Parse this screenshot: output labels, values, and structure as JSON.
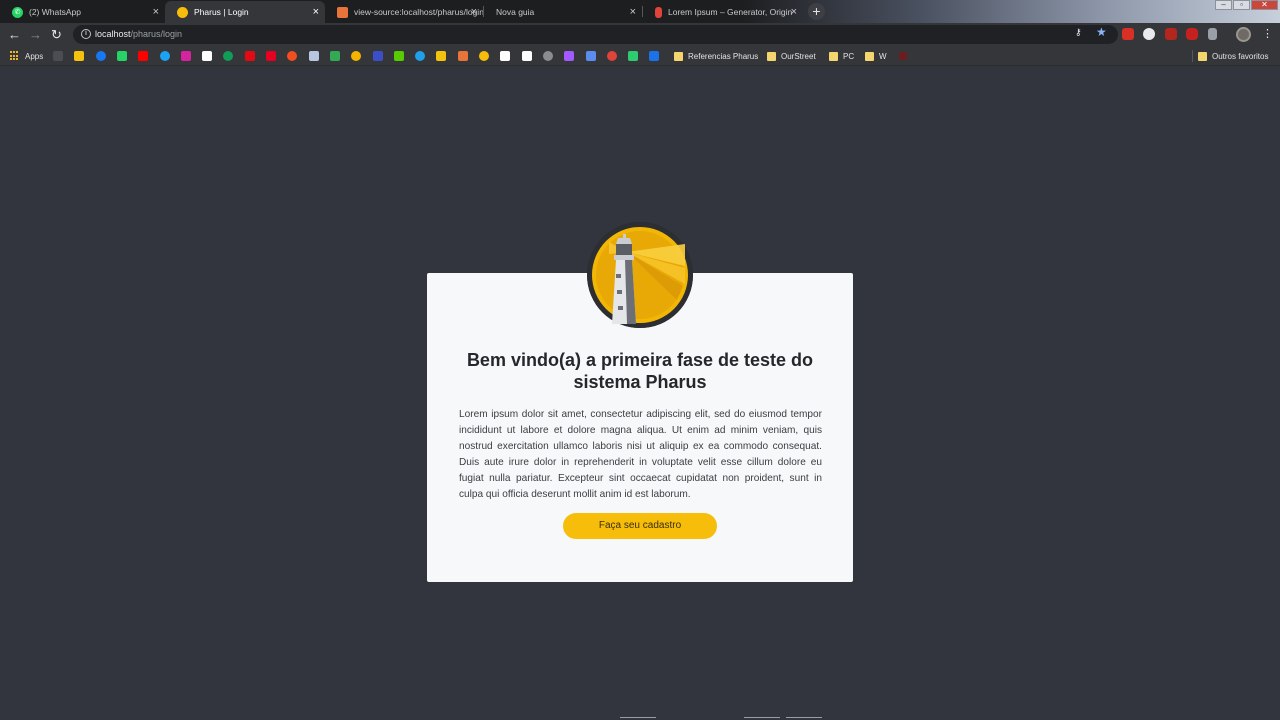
{
  "browser": {
    "tabs": [
      {
        "title": "(2) WhatsApp",
        "icon": "whatsapp-icon",
        "color": "#25d366",
        "active": false
      },
      {
        "title": "Pharus | Login",
        "icon": "pharus-icon",
        "color": "#f6bd0b",
        "active": true
      },
      {
        "title": "view-source:localhost/pharus/login",
        "icon": "view-source-icon",
        "color": "#e8743b",
        "active": false
      },
      {
        "title": "Nova guia",
        "icon": "",
        "color": "",
        "active": false
      },
      {
        "title": "Lorem Ipsum – Generator, Origin",
        "icon": "lorem-ipsum-icon",
        "color": "#e0433a",
        "active": false
      }
    ],
    "new_tab_label": "+",
    "close_label": "×",
    "url_host": "localhost",
    "url_path": "/pharus/login",
    "bookmarks": {
      "apps_label": "Apps",
      "folders": [
        {
          "label": "Referencias Pharus"
        },
        {
          "label": "OurStreet"
        },
        {
          "label": "PC"
        },
        {
          "label": "W"
        }
      ],
      "other_label": "Outros favoritos"
    }
  },
  "login": {
    "title": "Bem vindo(a) a primeira fase de teste do sistema Pharus",
    "body": "Lorem ipsum dolor sit amet, consectetur adipiscing elit, sed do eiusmod tempor incididunt ut labore et dolore magna aliqua. Ut enim ad minim veniam, quis nostrud exercitation ullamco laboris nisi ut aliquip ex ea commodo consequat. Duis aute irure dolor in reprehenderit in voluptate velit esse cillum dolore eu fugiat nulla pariatur. Excepteur sint occaecat cupidatat non proident, sunt in culpa qui officia deserunt mollit anim id est laborum.",
    "cta_label": "Faça seu cadastro",
    "accent_color": "#f6bd0b"
  }
}
